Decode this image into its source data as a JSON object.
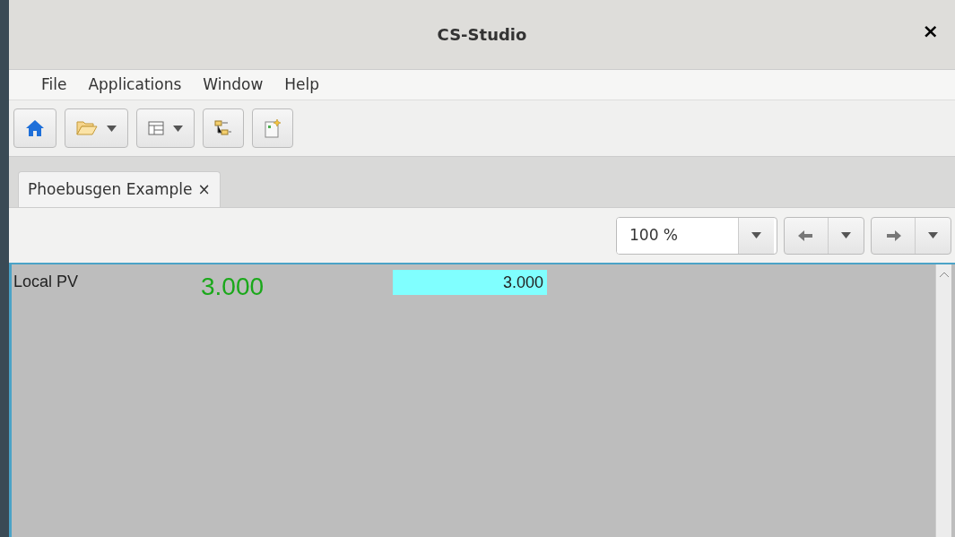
{
  "window": {
    "title": "CS-Studio",
    "close": "×"
  },
  "menu": [
    "File",
    "Applications",
    "Window",
    "Help"
  ],
  "toolbar": [
    {
      "kind": "home",
      "dropdown": false
    },
    {
      "kind": "folder",
      "dropdown": true
    },
    {
      "kind": "layout",
      "dropdown": true
    },
    {
      "kind": "tree",
      "dropdown": false
    },
    {
      "kind": "newdoc",
      "dropdown": false
    }
  ],
  "tabs": [
    {
      "label": "Phoebusgen Example",
      "close": "×",
      "selected": true
    }
  ],
  "nav": {
    "zoom": "100 %"
  },
  "widgets": [
    {
      "kind": "label",
      "text": "Local PV",
      "color": "#222222"
    },
    {
      "kind": "textupdate",
      "text": "3.000",
      "color": "#1aa81a"
    },
    {
      "kind": "textentry",
      "text": "3.000",
      "color": "#80ffff"
    }
  ]
}
